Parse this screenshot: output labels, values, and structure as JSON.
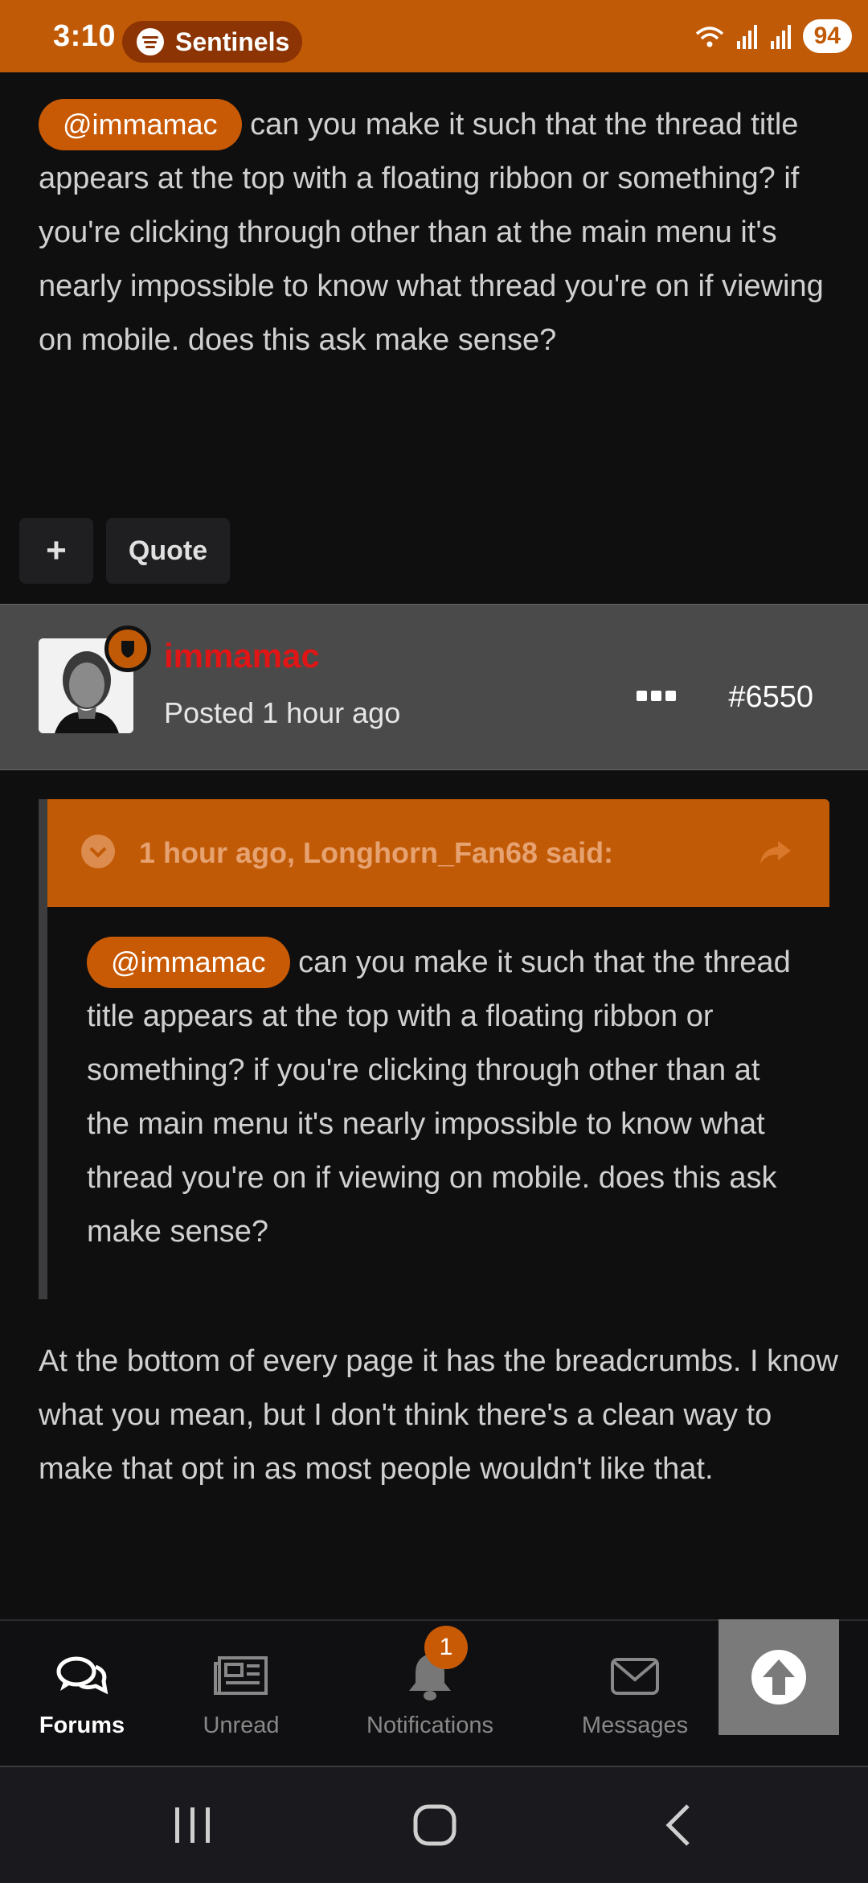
{
  "status_bar": {
    "time": "3:10",
    "spotify_label": "Sentinels",
    "battery": "94",
    "accent": "#c15a06"
  },
  "post_prev": {
    "mention": "@immamac",
    "text": " can you make it such that the thread title appears at the top with a floating ribbon or something? if you're clicking through other than at the main menu it's nearly impossible to know what thread you're on if viewing on mobile. does this ask make sense?",
    "buttons": {
      "plus": "+",
      "quote": "Quote"
    }
  },
  "post": {
    "author": "immamac",
    "posted": "Posted 1 hour ago",
    "number": "#6550",
    "author_color": "#e01515"
  },
  "quote": {
    "header": "1 hour ago, Longhorn_Fan68 said:",
    "mention": "@immamac",
    "text": " can you make it such that the thread title appears at the top with a floating ribbon or something? if you're clicking through other than at the main menu it's nearly impossible to know what thread you're on if viewing on mobile. does this ask make sense?"
  },
  "reply": {
    "text": "At the bottom of every page it has the breadcrumbs. I know what you mean, but I don't think there's a clean way to make that opt in as most people wouldn't like that."
  },
  "bottom_nav": {
    "forums": "Forums",
    "unread": "Unread",
    "notifications": "Notifications",
    "notifications_count": "1",
    "messages": "Messages"
  }
}
